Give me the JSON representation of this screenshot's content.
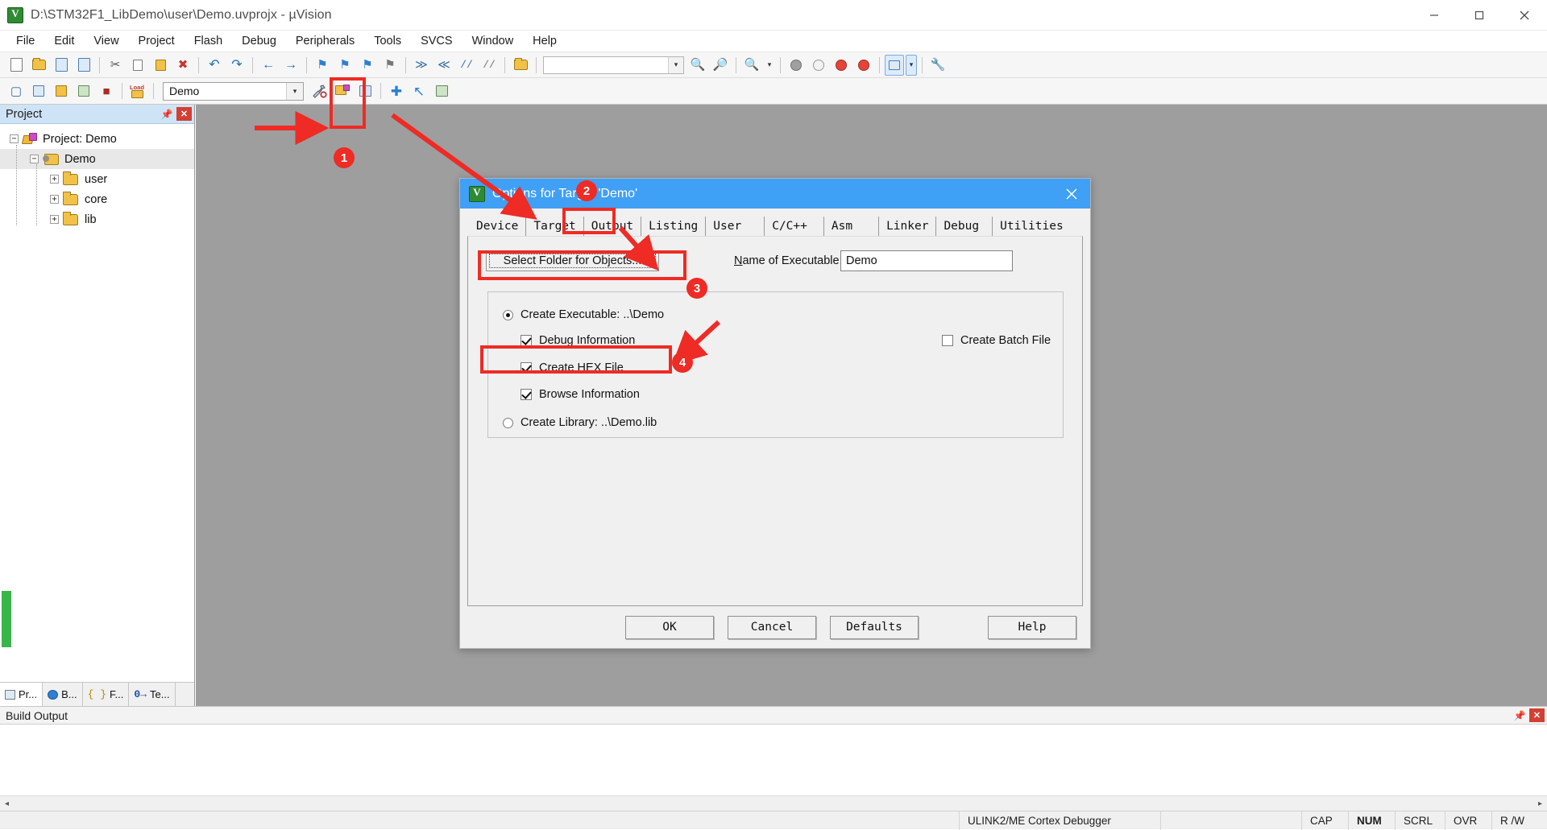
{
  "window": {
    "title": "D:\\STM32F1_LibDemo\\user\\Demo.uvprojx - µVision",
    "app_icon": "uvision-logo-icon",
    "minimize": "–",
    "maximize": "□",
    "close": "✕"
  },
  "menubar": {
    "items": [
      {
        "label": "File"
      },
      {
        "label": "Edit"
      },
      {
        "label": "View"
      },
      {
        "label": "Project"
      },
      {
        "label": "Flash"
      },
      {
        "label": "Debug"
      },
      {
        "label": "Peripherals"
      },
      {
        "label": "Tools"
      },
      {
        "label": "SVCS"
      },
      {
        "label": "Window"
      },
      {
        "label": "Help"
      }
    ]
  },
  "toolbar2": {
    "target_value": "Demo",
    "target_chevron": "▾"
  },
  "find_box": {
    "value": "",
    "chevron": "▾"
  },
  "project_panel": {
    "title": "Project",
    "pin_icon": "pin-icon",
    "close_icon": "close-icon",
    "tree": [
      {
        "label": "Project: Demo",
        "expander": "−",
        "icon": "project-icon",
        "level": 0
      },
      {
        "label": "Demo",
        "expander": "−",
        "icon": "target-icon",
        "level": 1
      },
      {
        "label": "user",
        "expander": "+",
        "icon": "folder-icon",
        "level": 2
      },
      {
        "label": "core",
        "expander": "+",
        "icon": "folder-icon",
        "level": 2
      },
      {
        "label": "lib",
        "expander": "+",
        "icon": "folder-icon",
        "level": 2
      }
    ],
    "tabs": [
      {
        "label": "Pr...",
        "icon": "project-window-icon",
        "active": true
      },
      {
        "label": "B...",
        "icon": "books-icon",
        "active": false
      },
      {
        "label": "F...",
        "icon": "functions-icon",
        "active": false
      },
      {
        "label": "Te...",
        "icon": "templates-icon",
        "active": false
      }
    ]
  },
  "build_output": {
    "title": "Build Output",
    "pin_icon": "pin-icon",
    "close_icon": "close-icon",
    "content": "",
    "scroll_left": "◂",
    "scroll_right": "▸"
  },
  "statusbar": {
    "debugger": "ULINK2/ME Cortex Debugger",
    "cells": [
      "CAP",
      "NUM",
      "SCRL",
      "OVR",
      "R /W"
    ]
  },
  "dialog": {
    "title": "Options for Target 'Demo'",
    "icon": "uvision-logo-icon",
    "close": "✕",
    "tabs": [
      {
        "label": "Device",
        "active": false
      },
      {
        "label": "Target",
        "active": false
      },
      {
        "label": "Output",
        "active": true
      },
      {
        "label": "Listing",
        "active": false
      },
      {
        "label": "User",
        "active": false
      },
      {
        "label": "C/C++",
        "active": false
      },
      {
        "label": "Asm",
        "active": false
      },
      {
        "label": "Linker",
        "active": false
      },
      {
        "label": "Debug",
        "active": false
      },
      {
        "label": "Utilities",
        "active": false
      }
    ],
    "select_folder_button": "Select Folder for Objects...",
    "name_of_executable_label": "Name of Executable:",
    "name_of_executable_value": "Demo",
    "options": [
      {
        "type": "radio",
        "checked": true,
        "label": "Create Executable:  ..\\Demo"
      },
      {
        "type": "checkbox",
        "checked": true,
        "label": "Debug Information"
      },
      {
        "type": "checkbox",
        "checked": true,
        "label": "Create HEX File"
      },
      {
        "type": "checkbox",
        "checked": true,
        "label": "Browse Information"
      },
      {
        "type": "radio",
        "checked": false,
        "label": "Create Library:  ..\\Demo.lib"
      }
    ],
    "create_batch_file": {
      "checked": false,
      "label": "Create Batch File"
    },
    "buttons": [
      {
        "label": "OK"
      },
      {
        "label": "Cancel"
      },
      {
        "label": "Defaults"
      },
      {
        "label": "Help"
      }
    ]
  },
  "annotations": {
    "accent_color": "#ee2b24",
    "steps": [
      {
        "number": "1",
        "target": "options-for-target-toolbar-button"
      },
      {
        "number": "2",
        "target": "output-tab"
      },
      {
        "number": "3",
        "target": "select-folder-for-objects-button"
      },
      {
        "number": "4",
        "target": "create-hex-file-checkbox"
      }
    ]
  }
}
